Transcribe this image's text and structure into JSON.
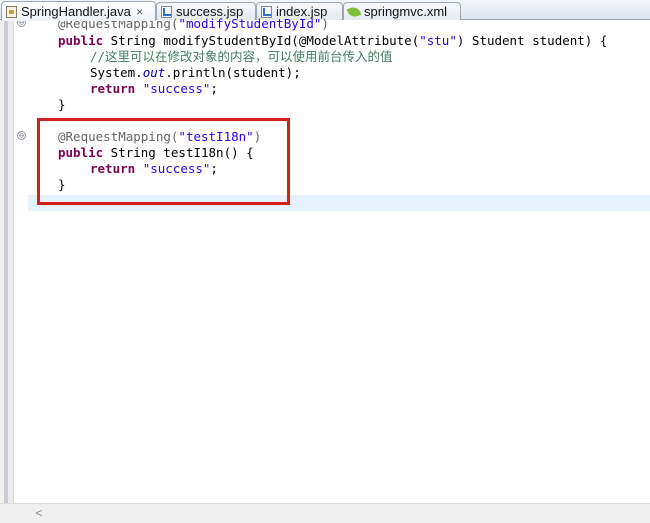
{
  "tabs": [
    {
      "label": "SpringHandler.java",
      "icon": "java-file-icon",
      "active": true,
      "close": "✕"
    },
    {
      "label": "success.jsp",
      "icon": "jsp-file-icon",
      "active": false
    },
    {
      "label": "index.jsp",
      "icon": "jsp-file-icon",
      "active": false
    },
    {
      "label": "springmvc.xml",
      "icon": "xml-file-icon",
      "active": false
    }
  ],
  "code": {
    "l0_annotation": "@RequestMapping(",
    "l0_string": "\"modifyStudentById\"",
    "l0_close": ")",
    "l1_kw": "public",
    "l1_rest": " String modifyStudentById(@ModelAttribute(",
    "l1_string": "\"stu\"",
    "l1_end": ") Student student) {",
    "l2_comment": "//这里可以在修改对象的内容，可以使用前台传入的值",
    "l3_start": "System.",
    "l3_field": "out",
    "l3_end": ".println(student);",
    "l4_kw": "return",
    "l4_string": "\"success\"",
    "l4_end": ";",
    "l5": "}",
    "l7_annotation": "@RequestMapping(",
    "l7_string": "\"testI18n\"",
    "l7_close": ")",
    "l8_kw": "public",
    "l8_rest": " String testI18n() {",
    "l9_kw": "return",
    "l9_string": "\"success\"",
    "l9_end": ";",
    "l10": "}"
  },
  "fold_marker": "⊖",
  "scroll_left_arrow": "<",
  "colors": {
    "highlight_border": "#d21f1f",
    "keyword": "#7f0055",
    "string": "#2a00ff",
    "comment": "#3f7f5f",
    "current_line": "#e8f2fe"
  }
}
